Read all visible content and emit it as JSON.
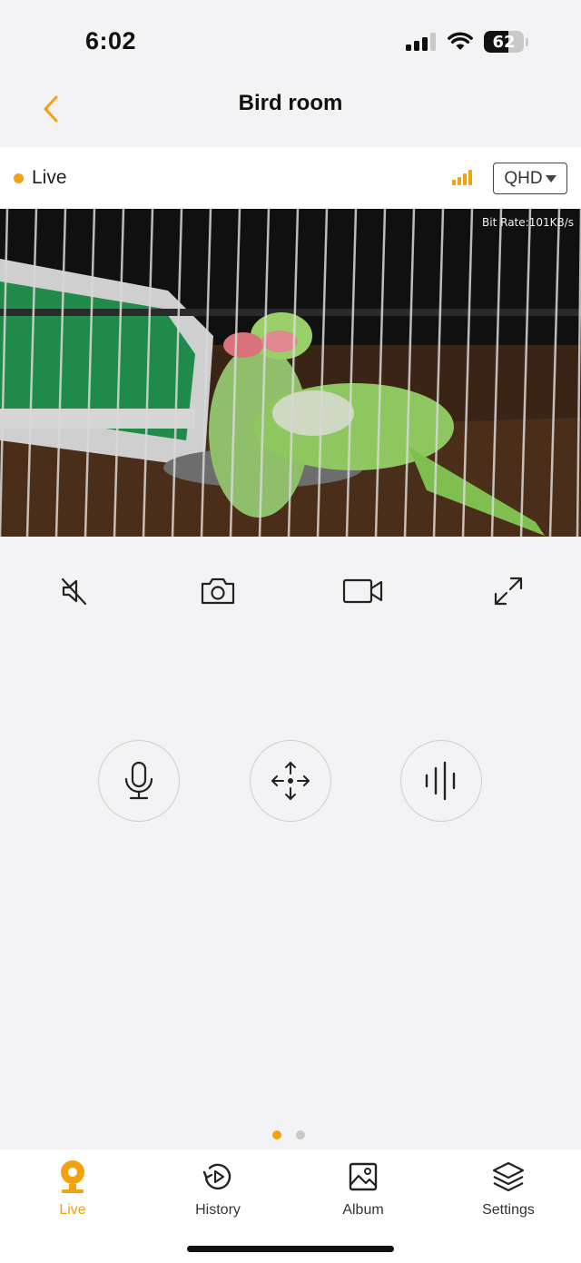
{
  "status_bar": {
    "time": "6:02",
    "battery": "62",
    "battery_level": 0.62
  },
  "nav": {
    "title": "Bird room"
  },
  "live_strip": {
    "live_label": "Live",
    "quality": "QHD"
  },
  "video": {
    "bitrate": "Bit Rate:101KB/s"
  },
  "controls": [
    "mute-icon",
    "camera-icon",
    "record-icon",
    "fullscreen-icon"
  ],
  "round_controls": [
    "microphone-icon",
    "pan-tilt-icon",
    "audio-wave-icon"
  ],
  "pager": {
    "count": 2,
    "active_index": 0
  },
  "tabs": [
    {
      "label": "Live",
      "icon": "live-icon",
      "active": true
    },
    {
      "label": "History",
      "icon": "history-icon",
      "active": false
    },
    {
      "label": "Album",
      "icon": "album-icon",
      "active": false
    },
    {
      "label": "Settings",
      "icon": "settings-icon",
      "active": false
    }
  ],
  "colors": {
    "accent": "#f3a20f",
    "background": "#f3f3f5"
  }
}
